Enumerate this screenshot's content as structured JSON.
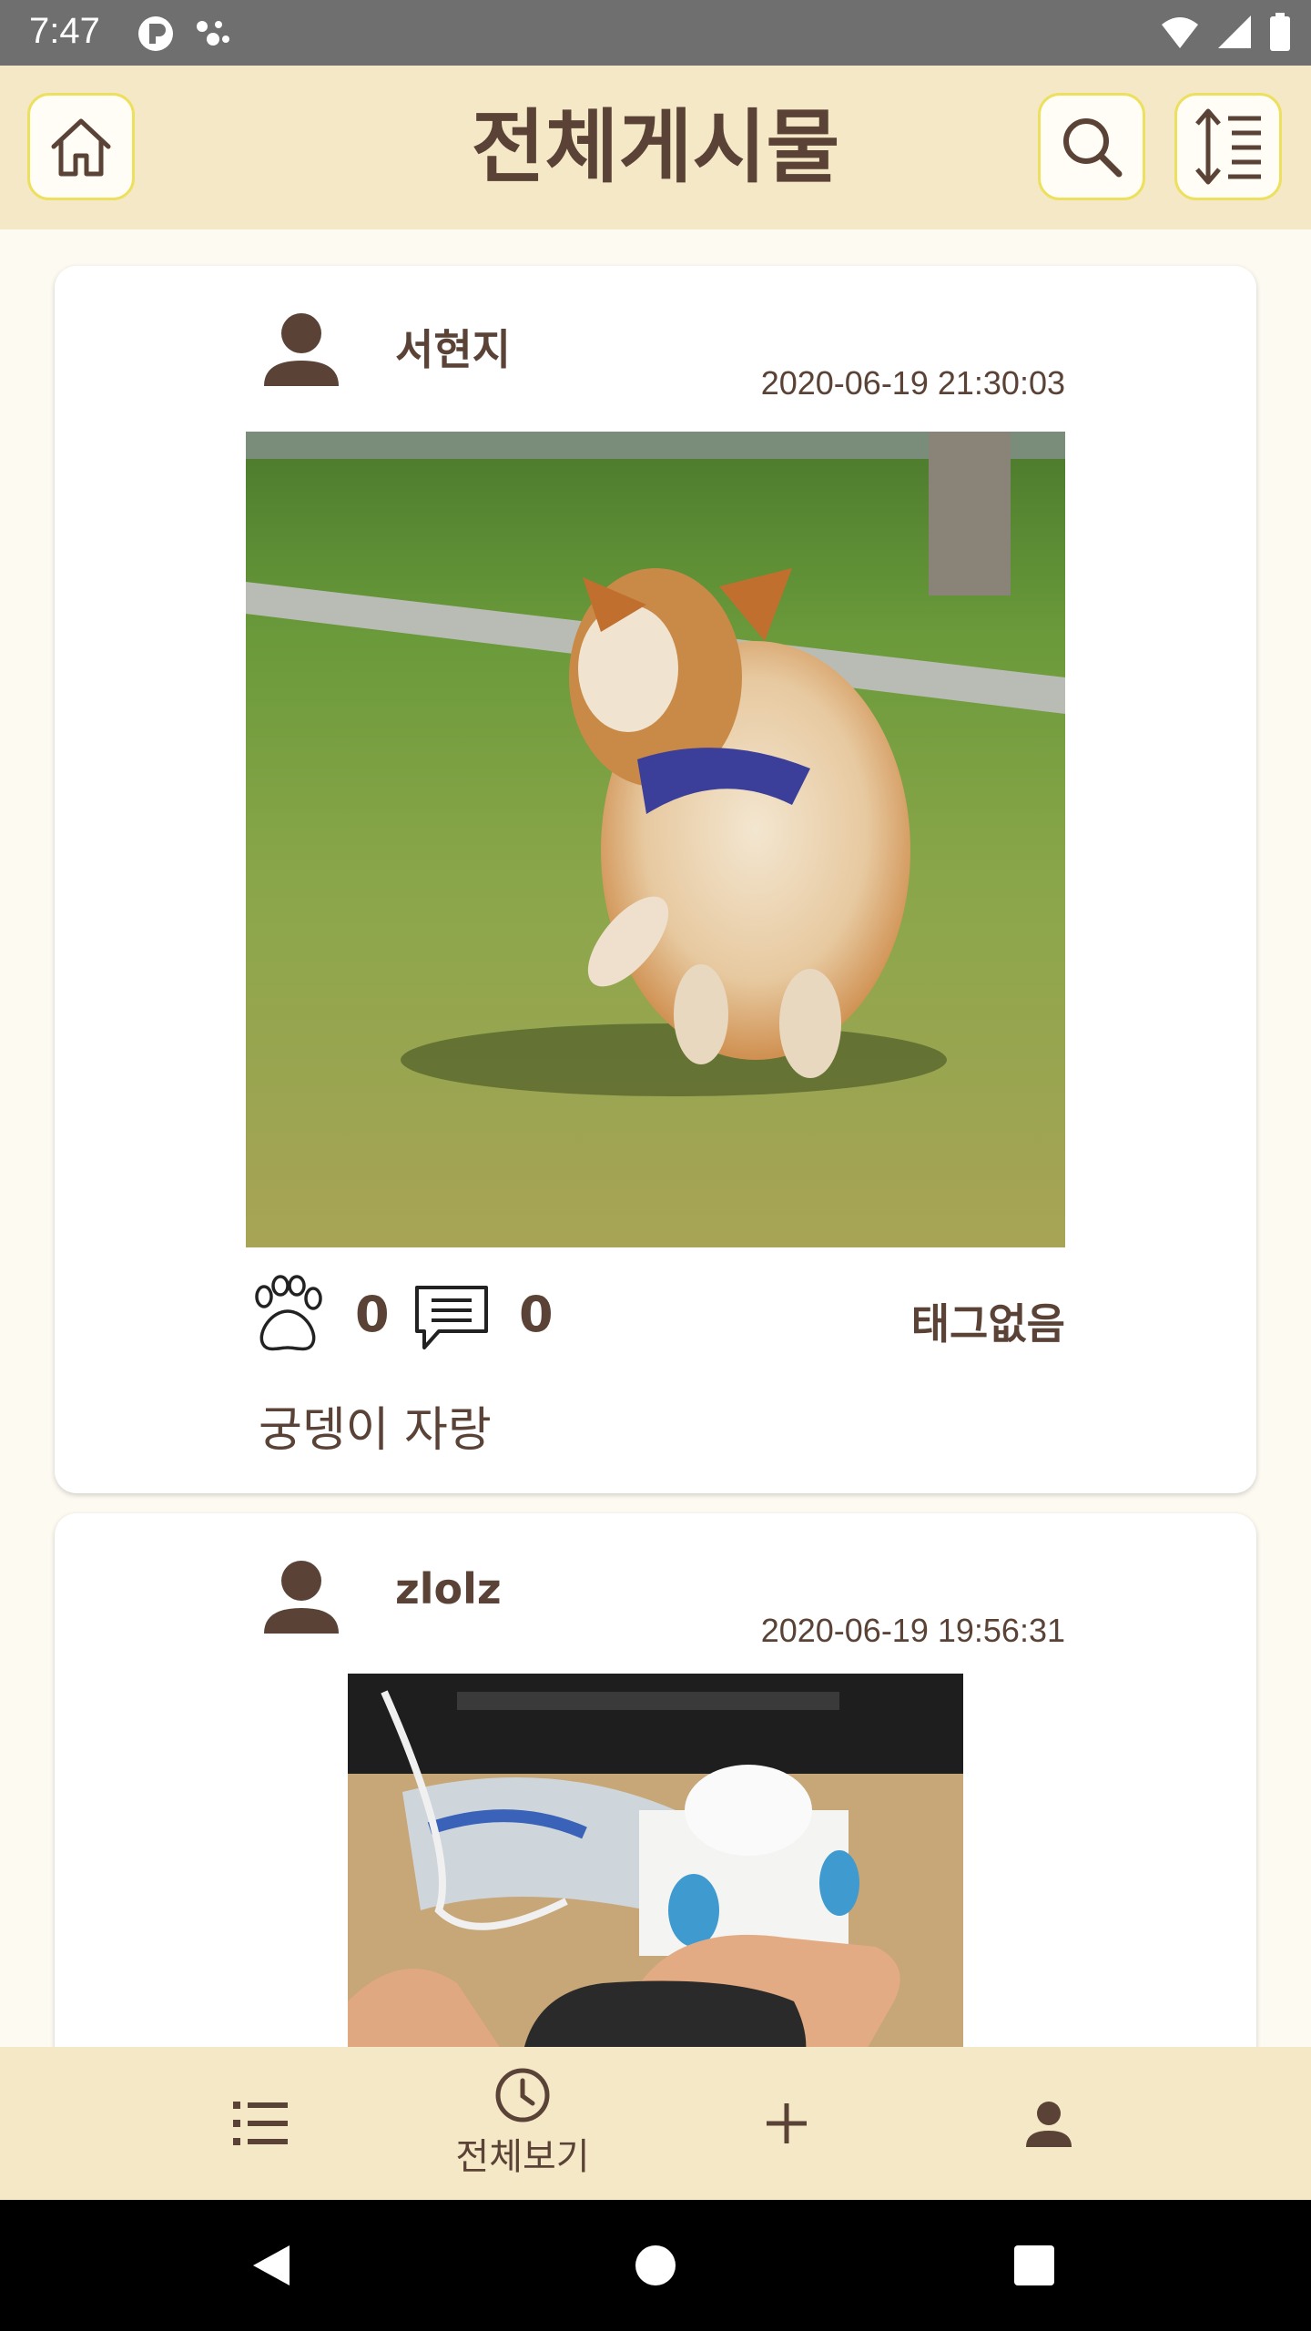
{
  "status_bar": {
    "time": "7:47"
  },
  "header": {
    "title": "전체게시물",
    "home_icon": "home-icon",
    "search_icon": "search-icon",
    "sort_icon": "sort-icon"
  },
  "posts": [
    {
      "author": "서현지",
      "date": "2020-06-19 21:30:03",
      "likes": "0",
      "comments": "0",
      "tag": "태그없음",
      "caption": "궁뎅이 자랑"
    },
    {
      "author": "zlolz",
      "date": "2020-06-19 19:56:31"
    }
  ],
  "bottom_nav": {
    "items": [
      {
        "icon": "list-icon",
        "label": ""
      },
      {
        "icon": "clock-icon",
        "label": "전체보기"
      },
      {
        "icon": "plus-icon",
        "label": ""
      },
      {
        "icon": "person-icon",
        "label": ""
      }
    ]
  },
  "colors": {
    "header_bg": "#f4e8c6",
    "text_brown": "#5a4336",
    "button_border": "#ece05e",
    "page_bg": "#fdfaf2"
  }
}
